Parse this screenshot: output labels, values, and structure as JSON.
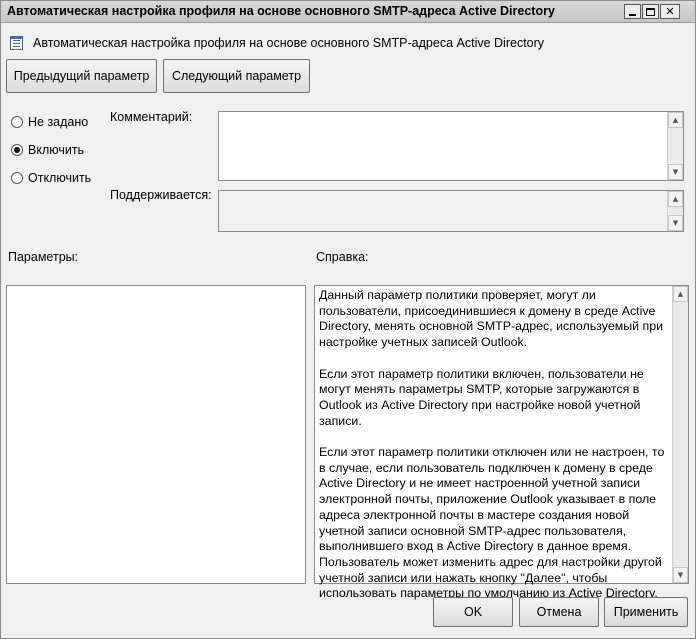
{
  "window": {
    "title": "Автоматическая настройка профиля на основе основного SMTP-адреса Active Directory",
    "controls": {
      "minimize_icon": "minimize-icon",
      "maximize_icon": "maximize-icon",
      "close_icon": "close-icon",
      "close_glyph": "✕"
    }
  },
  "header": {
    "icon": "policy-setting-icon",
    "title": "Автоматическая настройка профиля на основе основного SMTP-адреса Active Directory"
  },
  "nav": {
    "prev_label": "Предыдущий параметр",
    "next_label": "Следующий параметр"
  },
  "state": {
    "options": [
      {
        "label": "Не задано",
        "selected": false
      },
      {
        "label": "Включить",
        "selected": true
      },
      {
        "label": "Отключить",
        "selected": false
      }
    ]
  },
  "comment": {
    "label": "Комментарий:",
    "value": ""
  },
  "supported": {
    "label": "Поддерживается:",
    "value": ""
  },
  "params": {
    "label": "Параметры:"
  },
  "help": {
    "label": "Справка:",
    "paragraphs": [
      "Данный параметр политики проверяет, могут ли пользователи, присоединившиеся к домену в среде Active Directory, менять основной SMTP-адрес, используемый при настройке учетных записей Outlook.",
      "Если этот параметр политики включен, пользователи не могут менять параметры SMTP, которые загружаются в Outlook из Active Directory при настройке новой учетной записи.",
      "Если этот параметр политики отключен или не настроен, то в случае, если пользователь подключен к домену в среде Active Directory и не имеет настроенной учетной записи электронной почты, приложение Outlook указывает в поле адреса электронной почты в мастере создания новой учетной записи основной SMTP-адрес пользователя, выполнившего вход в Active Directory в данное время. Пользователь может изменить адрес для настройки другой учетной записи или нажать кнопку \"Далее\", чтобы использовать параметры по умолчанию из Active Directory."
    ]
  },
  "footer": {
    "ok_label": "OK",
    "cancel_label": "Отмена",
    "apply_label": "Применить"
  },
  "scroll": {
    "up_glyph": "▲",
    "down_glyph": "▼"
  }
}
